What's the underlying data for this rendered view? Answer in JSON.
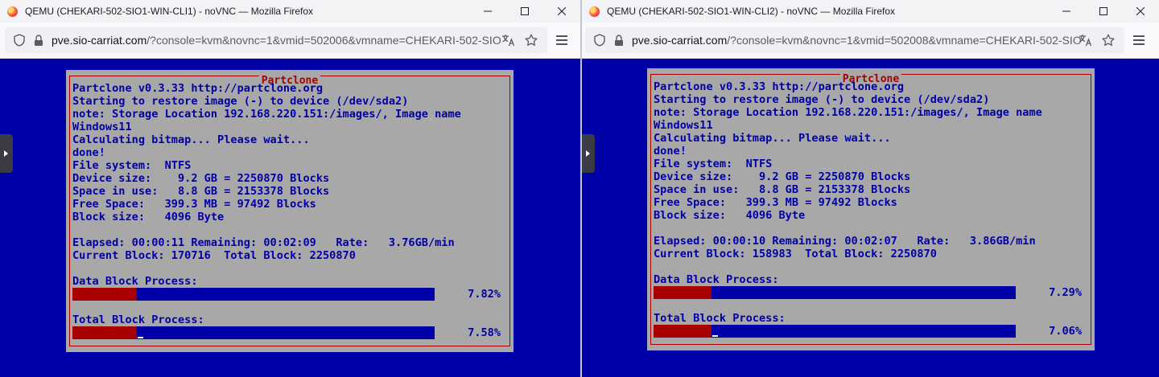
{
  "windows": [
    {
      "title": "QEMU (CHEKARI-502-SIO1-WIN-CLI1) - noVNC — Mozilla Firefox",
      "url_host": "pve.sio-carriat.com",
      "url_path": "/?console=kvm&novnc=1&vmid=502006&vmname=CHEKARI-502-SIO",
      "console": {
        "frame_title": "Partclone",
        "lines": [
          "Partclone v0.3.33 http://partclone.org",
          "Starting to restore image (-) to device (/dev/sda2)",
          "note: Storage Location 192.168.220.151:/images/, Image name",
          "Windows11",
          "Calculating bitmap... Please wait...",
          "done!",
          "File system:  NTFS",
          "Device size:    9.2 GB = 2250870 Blocks",
          "Space in use:   8.8 GB = 2153378 Blocks",
          "Free Space:   399.3 MB = 97492 Blocks",
          "Block size:   4096 Byte",
          "",
          "Elapsed: 00:00:11 Remaining: 00:02:09   Rate:   3.76GB/min",
          "Current Block: 170716  Total Block: 2250870"
        ],
        "data_label": "Data Block Process:",
        "data_percent": "7.82%",
        "data_progress": 7.82,
        "total_label": "Total Block Process:",
        "total_percent": "7.58%",
        "total_progress": 7.58
      }
    },
    {
      "title": "QEMU (CHEKARI-502-SIO1-WIN-CLI2) - noVNC — Mozilla Firefox",
      "url_host": "pve.sio-carriat.com",
      "url_path": "/?console=kvm&novnc=1&vmid=502008&vmname=CHEKARI-502-SIO",
      "console": {
        "frame_title": "Partclone",
        "lines": [
          "Partclone v0.3.33 http://partclone.org",
          "Starting to restore image (-) to device (/dev/sda2)",
          "note: Storage Location 192.168.220.151:/images/, Image name",
          "Windows11",
          "Calculating bitmap... Please wait...",
          "done!",
          "File system:  NTFS",
          "Device size:    9.2 GB = 2250870 Blocks",
          "Space in use:   8.8 GB = 2153378 Blocks",
          "Free Space:   399.3 MB = 97492 Blocks",
          "Block size:   4096 Byte",
          "",
          "Elapsed: 00:00:10 Remaining: 00:02:07   Rate:   3.86GB/min",
          "Current Block: 158983  Total Block: 2250870"
        ],
        "data_label": "Data Block Process:",
        "data_percent": "7.29%",
        "data_progress": 7.29,
        "total_label": "Total Block Process:",
        "total_percent": "7.06%",
        "total_progress": 7.06
      }
    }
  ],
  "icons": {
    "browser": "firefox-icon",
    "minimize": "minimize-icon",
    "maximize": "maximize-icon",
    "close": "close-icon",
    "tracking": "shield-icon",
    "lock": "lock-icon",
    "translate": "translate-icon",
    "bookmark": "star-icon",
    "menu": "hamburger-menu-icon",
    "sidebar_handle": "chevron-right-icon"
  },
  "colors": {
    "console_background": "#0000a8",
    "dialog_background": "#a8a8a8",
    "console_text": "#0000a8",
    "frame_and_progress": "#a80000"
  }
}
